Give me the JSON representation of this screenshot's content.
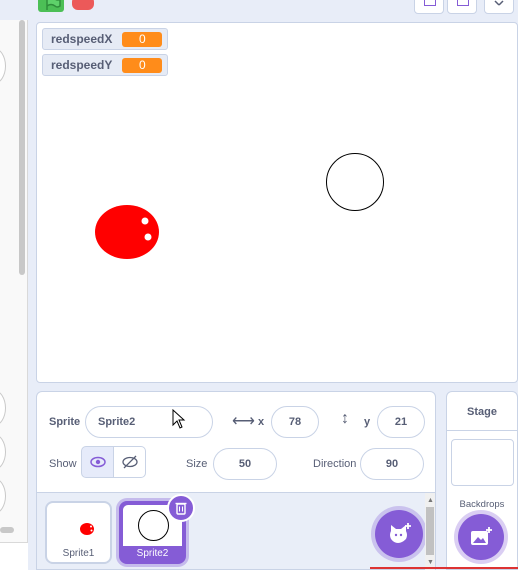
{
  "monitors": [
    {
      "label": "redspeedX",
      "value": "0"
    },
    {
      "label": "redspeedY",
      "value": "0"
    }
  ],
  "sprite_info": {
    "sprite_label": "Sprite",
    "sprite_name": "Sprite2",
    "x_label": "x",
    "x_value": "78",
    "y_label": "y",
    "y_value": "21",
    "show_label": "Show",
    "size_label": "Size",
    "size_value": "50",
    "direction_label": "Direction",
    "direction_value": "90"
  },
  "sprites": [
    {
      "name": "Sprite1",
      "selected": false
    },
    {
      "name": "Sprite2",
      "selected": true
    }
  ],
  "stage_pane": {
    "title": "Stage",
    "backdrops_label": "Backdrops"
  },
  "colors": {
    "accent": "#855cd6",
    "monitor_value": "#ff8c1a",
    "red_sprite": "#ff0000",
    "green_flag": "#4cbf56",
    "stop": "#ec5959"
  }
}
